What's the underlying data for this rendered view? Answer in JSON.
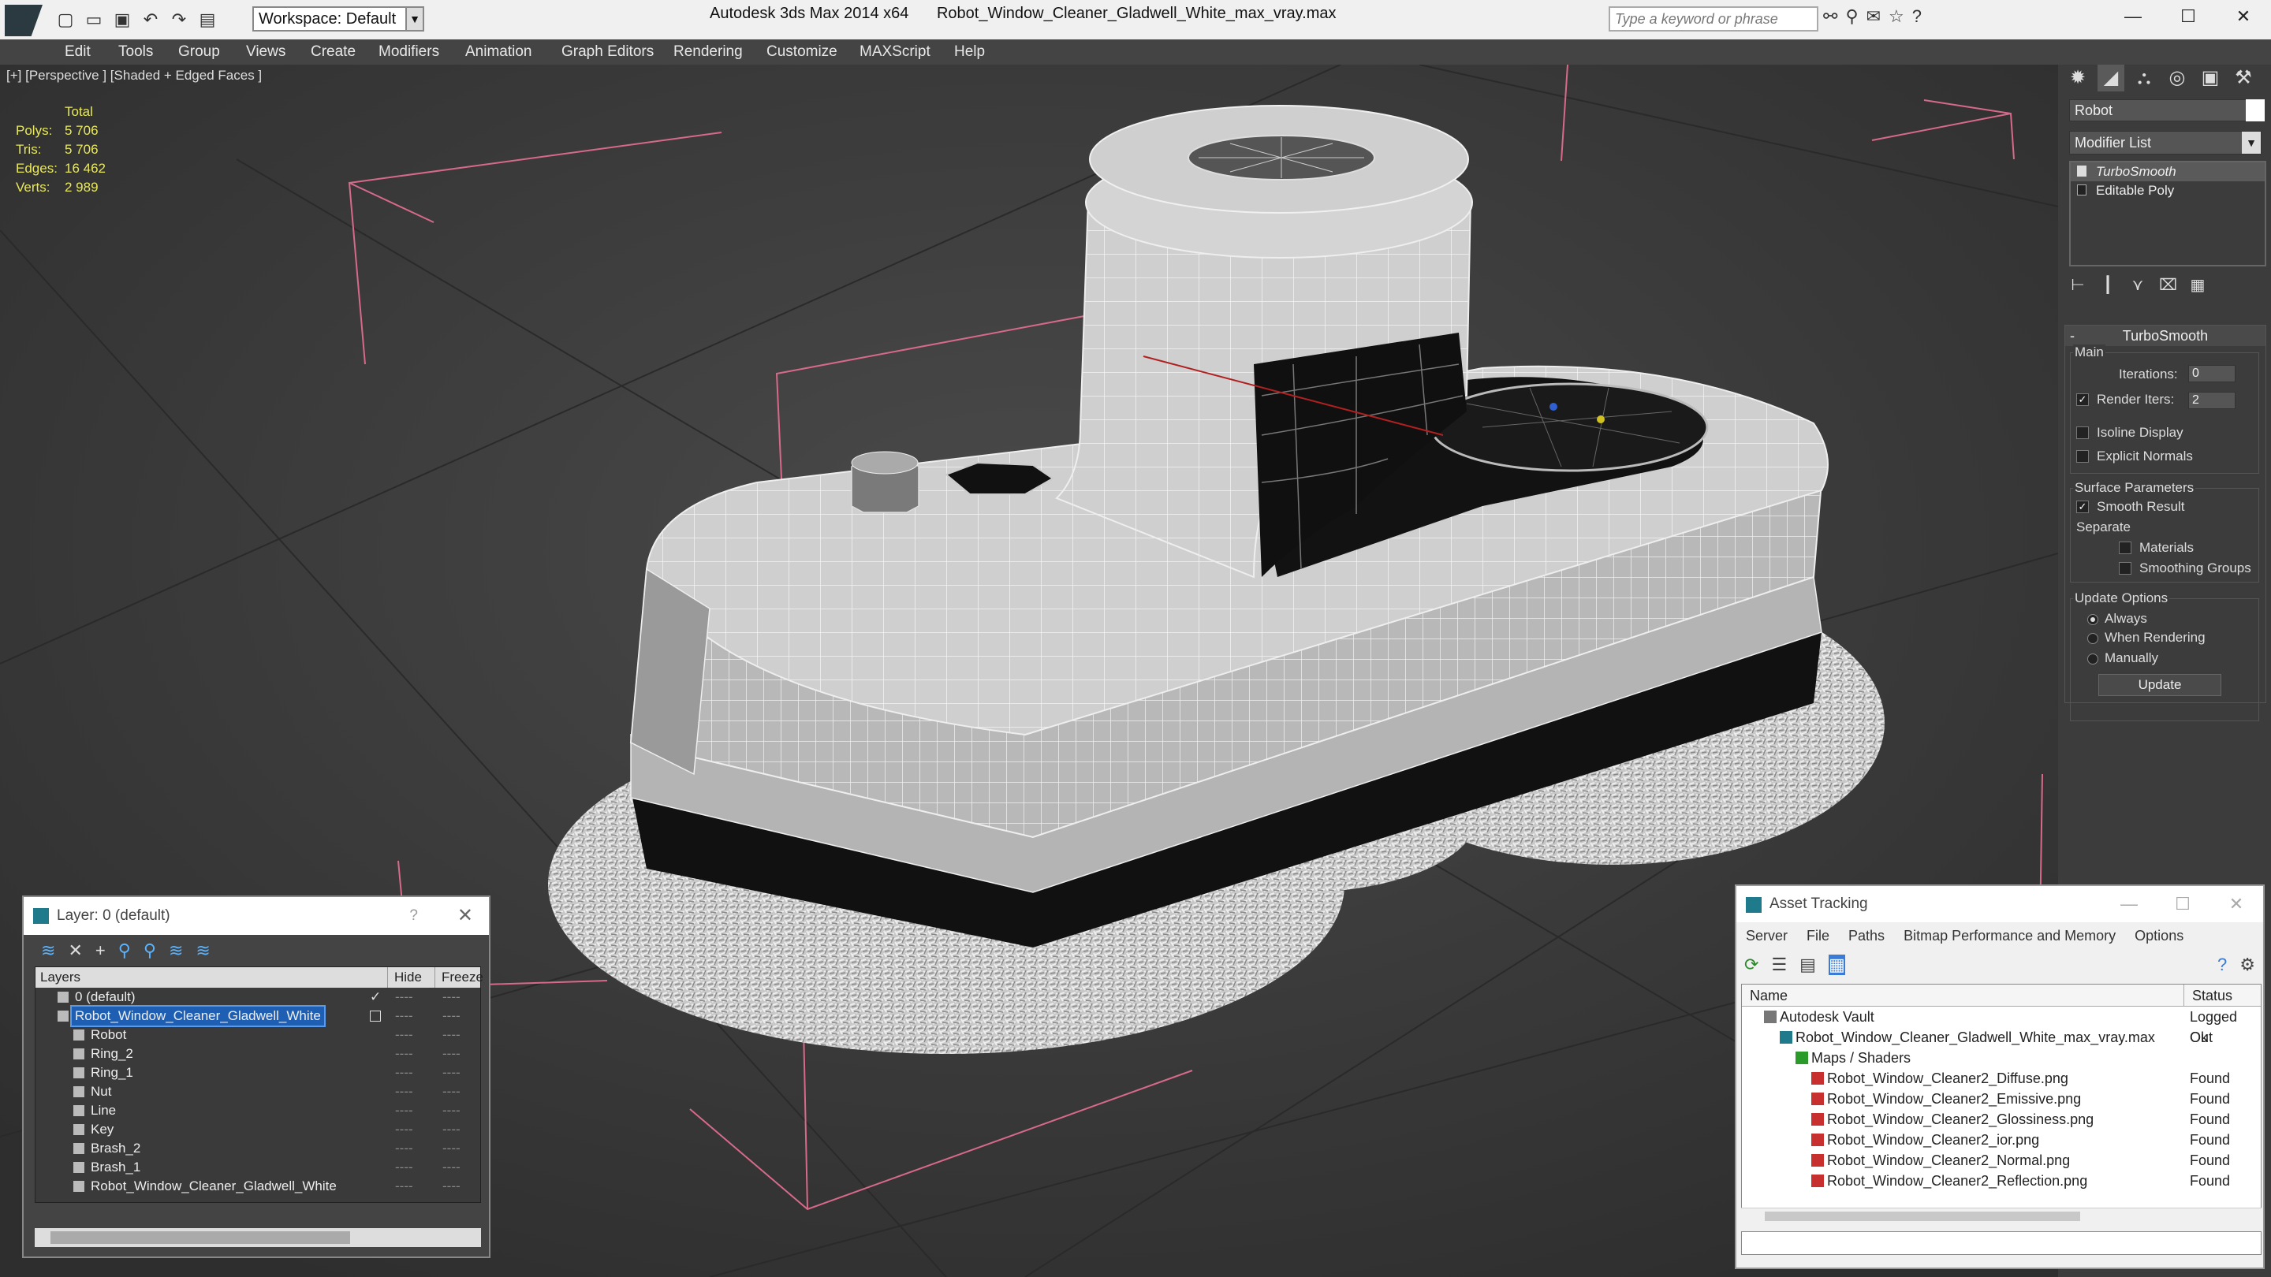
{
  "titlebar": {
    "app_name": "Autodesk 3ds Max  2014 x64",
    "file_name": "Robot_Window_Cleaner_Gladwell_White_max_vray.max",
    "workspace": "Workspace: Default",
    "search_placeholder": "Type a keyword or phrase"
  },
  "menu": [
    "Edit",
    "Tools",
    "Group",
    "Views",
    "Create",
    "Modifiers",
    "Animation",
    "Graph Editors",
    "Rendering",
    "Customize",
    "MAXScript",
    "Help"
  ],
  "viewport": {
    "label": "[+] [Perspective ] [Shaded + Edged Faces ]",
    "stats": {
      "header": "Total",
      "rows": [
        {
          "k": "Polys:",
          "v": "5 706"
        },
        {
          "k": "Tris:",
          "v": "5 706"
        },
        {
          "k": "Edges:",
          "v": "16 462"
        },
        {
          "k": "Verts:",
          "v": "2 989"
        }
      ]
    }
  },
  "command_panel": {
    "object_name": "Robot",
    "modifier_list": "Modifier List",
    "stack": [
      "TurboSmooth",
      "Editable Poly"
    ],
    "rollout_title": "TurboSmooth",
    "main_label": "Main",
    "iterations_label": "Iterations:",
    "iterations_value": "0",
    "render_iters_label": "Render Iters:",
    "render_iters_value": "2",
    "isoline_label": "Isoline Display",
    "explicit_label": "Explicit Normals",
    "surface_label": "Surface Parameters",
    "smooth_label": "Smooth Result",
    "separate_label": "Separate",
    "materials_label": "Materials",
    "smoothing_groups_label": "Smoothing Groups",
    "update_options_label": "Update Options",
    "always_label": "Always",
    "when_rendering_label": "When Rendering",
    "manually_label": "Manually",
    "update_button": "Update"
  },
  "layer_window": {
    "title": "Layer: 0 (default)",
    "help": "?",
    "headers": {
      "layers": "Layers",
      "hide": "Hide",
      "freeze": "Freeze"
    },
    "rows": [
      {
        "name": "0 (default)",
        "indent": 1,
        "type": "layer"
      },
      {
        "name": "Robot_Window_Cleaner_Gladwell_White",
        "indent": 1,
        "type": "layer",
        "selected": true
      },
      {
        "name": "Robot",
        "indent": 2,
        "type": "obj"
      },
      {
        "name": "Ring_2",
        "indent": 2,
        "type": "obj"
      },
      {
        "name": "Ring_1",
        "indent": 2,
        "type": "obj"
      },
      {
        "name": "Nut",
        "indent": 2,
        "type": "obj"
      },
      {
        "name": "Line",
        "indent": 2,
        "type": "obj"
      },
      {
        "name": "Key",
        "indent": 2,
        "type": "obj"
      },
      {
        "name": "Brash_2",
        "indent": 2,
        "type": "obj"
      },
      {
        "name": "Brash_1",
        "indent": 2,
        "type": "obj"
      },
      {
        "name": "Robot_Window_Cleaner_Gladwell_White",
        "indent": 2,
        "type": "obj"
      }
    ],
    "hide_marks": "----",
    "freeze_marks": "----"
  },
  "asset_window": {
    "title": "Asset Tracking",
    "menu": [
      "Server",
      "File",
      "Paths",
      "Bitmap Performance and Memory",
      "Options"
    ],
    "headers": {
      "name": "Name",
      "status": "Status"
    },
    "rows": [
      {
        "name": "Autodesk Vault",
        "status": "Logged Out",
        "indent": 1,
        "icon": "vault"
      },
      {
        "name": "Robot_Window_Cleaner_Gladwell_White_max_vray.max",
        "status": "Ok",
        "indent": 2,
        "icon": "max"
      },
      {
        "name": "Maps / Shaders",
        "status": "",
        "indent": 3,
        "icon": "maps"
      },
      {
        "name": "Robot_Window_Cleaner2_Diffuse.png",
        "status": "Found",
        "indent": 4,
        "icon": "png"
      },
      {
        "name": "Robot_Window_Cleaner2_Emissive.png",
        "status": "Found",
        "indent": 4,
        "icon": "png"
      },
      {
        "name": "Robot_Window_Cleaner2_Glossiness.png",
        "status": "Found",
        "indent": 4,
        "icon": "png"
      },
      {
        "name": "Robot_Window_Cleaner2_ior.png",
        "status": "Found",
        "indent": 4,
        "icon": "png"
      },
      {
        "name": "Robot_Window_Cleaner2_Normal.png",
        "status": "Found",
        "indent": 4,
        "icon": "png"
      },
      {
        "name": "Robot_Window_Cleaner2_Reflection.png",
        "status": "Found",
        "indent": 4,
        "icon": "png"
      }
    ]
  }
}
